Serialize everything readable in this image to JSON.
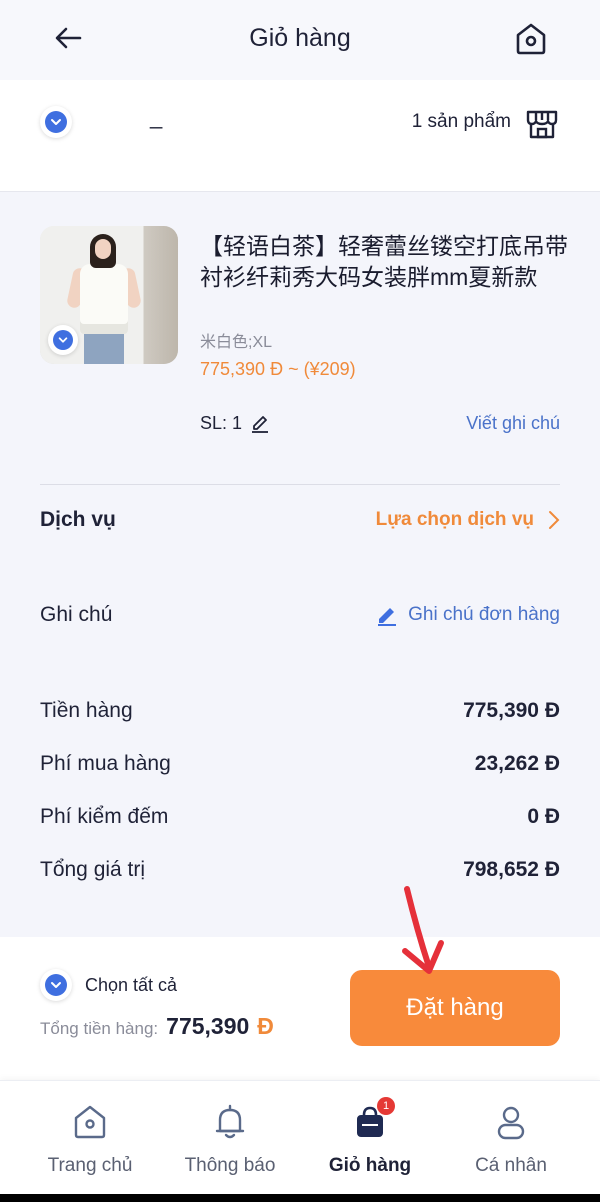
{
  "header": {
    "title": "Giỏ hàng",
    "back_icon": "back-arrow-icon",
    "home_icon": "home-icon"
  },
  "shop": {
    "name": "_",
    "product_count": "1 sản phẩm",
    "store_icon": "store-icon"
  },
  "item": {
    "title": "【轻语白茶】轻奢蕾丝镂空打底吊带衬衫纤莉秀大码女装胖mm夏新款",
    "variant": "米白色;XL",
    "price": "775,390 Đ ~ (¥209)",
    "quantity_label": "SL: 1",
    "note_link": "Viết ghi chú"
  },
  "service": {
    "label": "Dịch vụ",
    "link": "Lựa chọn dịch vụ"
  },
  "note": {
    "label": "Ghi chú",
    "link": "Ghi chú đơn hàng"
  },
  "summary": [
    {
      "label": "Tiền hàng",
      "value": "775,390 Đ"
    },
    {
      "label": "Phí mua hàng",
      "value": "23,262 Đ"
    },
    {
      "label": "Phí kiểm đếm",
      "value": "0 Đ"
    },
    {
      "label": "Tổng giá trị",
      "value": "798,652 Đ"
    }
  ],
  "checkout": {
    "select_all": "Chọn tất cả",
    "total_label": "Tổng tiền hàng:",
    "total_value": "775,390",
    "currency": "Đ",
    "order_button": "Đặt hàng"
  },
  "tabs": [
    {
      "label": "Trang chủ",
      "icon": "home-icon"
    },
    {
      "label": "Thông báo",
      "icon": "bell-icon"
    },
    {
      "label": "Giỏ hàng",
      "icon": "cart-bag-icon",
      "badge": "1"
    },
    {
      "label": "Cá nhân",
      "icon": "person-icon"
    }
  ],
  "colors": {
    "accent": "#f88a3b",
    "link": "#4a72c9",
    "check": "#3f6fe0",
    "badge": "#e53935"
  }
}
